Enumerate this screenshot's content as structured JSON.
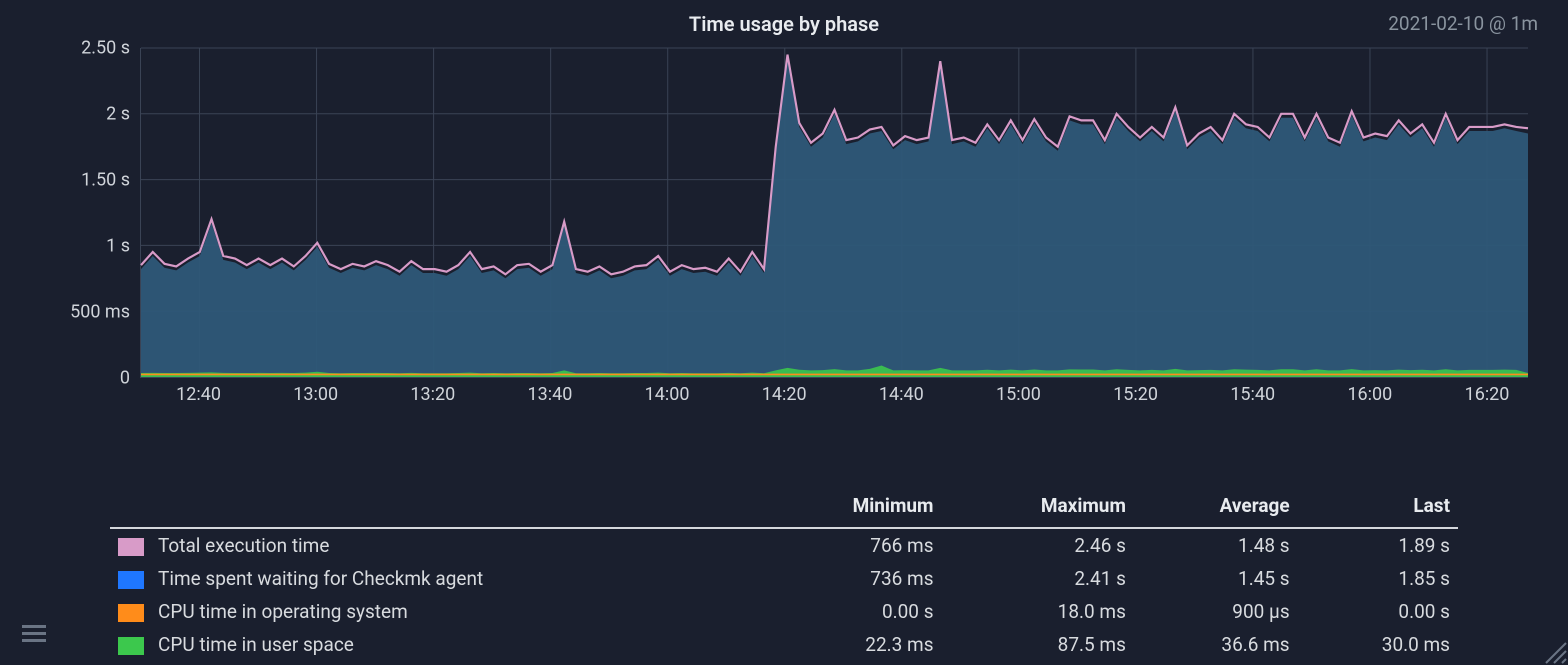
{
  "chart": {
    "title": "Time usage by phase",
    "timestamp": "2021-02-10 @ 1m"
  },
  "axes": {
    "y_ticks": [
      {
        "label": "0",
        "value": 0
      },
      {
        "label": "500 ms",
        "value": 0.5
      },
      {
        "label": "1 s",
        "value": 1.0
      },
      {
        "label": "1.50 s",
        "value": 1.5
      },
      {
        "label": "2 s",
        "value": 2.0
      },
      {
        "label": "2.50 s",
        "value": 2.5
      }
    ],
    "x_ticks": [
      "12:40",
      "13:00",
      "13:20",
      "13:40",
      "14:00",
      "14:20",
      "14:40",
      "15:00",
      "15:20",
      "15:40",
      "16:00",
      "16:20"
    ]
  },
  "legend": {
    "headers": [
      "",
      "Minimum",
      "Maximum",
      "Average",
      "Last"
    ],
    "rows": [
      {
        "label": "Total execution time",
        "color": "#d89bc8",
        "min": "766 ms",
        "max": "2.46 s",
        "avg": "1.48 s",
        "last": "1.89 s"
      },
      {
        "label": "Time spent waiting for Checkmk agent",
        "color": "#1f77ff",
        "min": "736 ms",
        "max": "2.41 s",
        "avg": "1.45 s",
        "last": "1.85 s"
      },
      {
        "label": "CPU time in operating system",
        "color": "#ff8c1a",
        "min": "0.00 s",
        "max": "18.0 ms",
        "avg": "900 µs",
        "last": "0.00 s"
      },
      {
        "label": "CPU time in user space",
        "color": "#3cc84d",
        "min": "22.3 ms",
        "max": "87.5 ms",
        "avg": "36.6 ms",
        "last": "30.0 ms"
      }
    ]
  },
  "chart_data": {
    "type": "area",
    "title": "Time usage by phase",
    "xlabel": "",
    "ylabel": "",
    "ylim": [
      0,
      2.5
    ],
    "x_range": [
      "12:30",
      "16:27"
    ],
    "x": [
      0,
      1,
      2,
      3,
      4,
      5,
      6,
      7,
      8,
      9,
      10,
      11,
      12,
      13,
      14,
      15,
      16,
      17,
      18,
      19,
      20,
      21,
      22,
      23,
      24,
      25,
      26,
      27,
      28,
      29,
      30,
      31,
      32,
      33,
      34,
      35,
      36,
      37,
      38,
      39,
      40,
      41,
      42,
      43,
      44,
      45,
      46,
      47,
      48,
      49,
      50,
      51,
      52,
      53,
      54,
      55,
      56,
      57,
      58,
      59,
      60,
      61,
      62,
      63,
      64,
      65,
      66,
      67,
      68,
      69,
      70,
      71,
      72,
      73,
      74,
      75,
      76,
      77,
      78,
      79,
      80,
      81,
      82,
      83,
      84,
      85,
      86,
      87,
      88,
      89,
      90,
      91,
      92,
      93,
      94,
      95,
      96,
      97,
      98,
      99,
      100,
      101,
      102,
      103,
      104,
      105,
      106,
      107,
      108,
      109,
      110,
      111,
      112,
      113,
      114,
      115,
      116,
      117,
      118
    ],
    "series": [
      {
        "name": "Total execution time",
        "color": "#d89bc8",
        "values": [
          0.85,
          0.95,
          0.86,
          0.84,
          0.9,
          0.95,
          1.2,
          0.92,
          0.9,
          0.85,
          0.9,
          0.85,
          0.9,
          0.84,
          0.92,
          1.02,
          0.86,
          0.82,
          0.86,
          0.84,
          0.88,
          0.85,
          0.8,
          0.88,
          0.82,
          0.82,
          0.8,
          0.85,
          0.95,
          0.82,
          0.84,
          0.78,
          0.85,
          0.86,
          0.8,
          0.85,
          1.18,
          0.82,
          0.8,
          0.84,
          0.78,
          0.8,
          0.84,
          0.85,
          0.92,
          0.8,
          0.85,
          0.82,
          0.83,
          0.8,
          0.9,
          0.8,
          0.95,
          0.82,
          1.75,
          2.45,
          1.93,
          1.78,
          1.85,
          2.03,
          1.8,
          1.82,
          1.88,
          1.9,
          1.76,
          1.83,
          1.8,
          1.82,
          2.4,
          1.8,
          1.82,
          1.78,
          1.92,
          1.8,
          1.95,
          1.8,
          1.96,
          1.82,
          1.75,
          1.98,
          1.95,
          1.95,
          1.8,
          2.0,
          1.9,
          1.82,
          1.9,
          1.82,
          2.05,
          1.76,
          1.85,
          1.9,
          1.8,
          2.0,
          1.92,
          1.9,
          1.82,
          2.0,
          2.0,
          1.82,
          2.0,
          1.82,
          1.78,
          2.02,
          1.82,
          1.85,
          1.83,
          1.95,
          1.85,
          1.92,
          1.78,
          2.0,
          1.8,
          1.9,
          1.9,
          1.9,
          1.92,
          1.9,
          1.89
        ]
      },
      {
        "name": "Time spent waiting for Checkmk agent",
        "color": "#1f77ff",
        "fill": "#2a5580",
        "values": [
          0.82,
          0.92,
          0.83,
          0.81,
          0.87,
          0.92,
          1.17,
          0.89,
          0.87,
          0.82,
          0.87,
          0.82,
          0.87,
          0.81,
          0.89,
          0.99,
          0.83,
          0.79,
          0.83,
          0.81,
          0.85,
          0.82,
          0.77,
          0.85,
          0.79,
          0.79,
          0.77,
          0.82,
          0.92,
          0.79,
          0.81,
          0.75,
          0.82,
          0.83,
          0.77,
          0.82,
          1.15,
          0.79,
          0.77,
          0.81,
          0.75,
          0.77,
          0.81,
          0.82,
          0.89,
          0.77,
          0.82,
          0.79,
          0.8,
          0.77,
          0.87,
          0.77,
          0.92,
          0.79,
          1.72,
          2.41,
          1.9,
          1.75,
          1.82,
          2.0,
          1.77,
          1.79,
          1.85,
          1.87,
          1.73,
          1.8,
          1.77,
          1.79,
          2.37,
          1.77,
          1.79,
          1.75,
          1.89,
          1.77,
          1.92,
          1.77,
          1.93,
          1.79,
          1.72,
          1.95,
          1.92,
          1.92,
          1.77,
          1.97,
          1.87,
          1.79,
          1.87,
          1.79,
          2.02,
          1.73,
          1.82,
          1.87,
          1.77,
          1.97,
          1.89,
          1.87,
          1.79,
          1.97,
          1.97,
          1.79,
          1.97,
          1.79,
          1.75,
          1.99,
          1.79,
          1.82,
          1.8,
          1.92,
          1.82,
          1.89,
          1.75,
          1.97,
          1.77,
          1.87,
          1.87,
          1.87,
          1.89,
          1.87,
          1.85
        ]
      },
      {
        "name": "CPU time in operating system",
        "color": "#ff8c1a",
        "values": [
          0.001,
          0.001,
          0.001,
          0.001,
          0.001,
          0.001,
          0.001,
          0.001,
          0.001,
          0.001,
          0.001,
          0.001,
          0.001,
          0.001,
          0.001,
          0.001,
          0.001,
          0.001,
          0.001,
          0.001,
          0.001,
          0.001,
          0.001,
          0.001,
          0.001,
          0.001,
          0.001,
          0.001,
          0.001,
          0.001,
          0.001,
          0.001,
          0.001,
          0.001,
          0.001,
          0.001,
          0.001,
          0.001,
          0.001,
          0.001,
          0.001,
          0.001,
          0.001,
          0.001,
          0.001,
          0.001,
          0.001,
          0.001,
          0.001,
          0.001,
          0.001,
          0.001,
          0.001,
          0.001,
          0.001,
          0.001,
          0.001,
          0.001,
          0.001,
          0.001,
          0.001,
          0.001,
          0.001,
          0.001,
          0.001,
          0.001,
          0.001,
          0.001,
          0.001,
          0.001,
          0.001,
          0.001,
          0.001,
          0.001,
          0.001,
          0.001,
          0.001,
          0.001,
          0.001,
          0.001,
          0.001,
          0.001,
          0.001,
          0.001,
          0.001,
          0.001,
          0.001,
          0.001,
          0.001,
          0.001,
          0.001,
          0.001,
          0.001,
          0.001,
          0.001,
          0.001,
          0.001,
          0.001,
          0.001,
          0.001,
          0.001,
          0.001,
          0.001,
          0.001,
          0.001,
          0.001,
          0.001,
          0.001,
          0.001,
          0.001,
          0.001,
          0.001,
          0.001,
          0.001,
          0.001,
          0.001,
          0.001,
          0.001,
          0.0
        ]
      },
      {
        "name": "CPU time in user space",
        "color": "#3cc84d",
        "values": [
          0.03,
          0.032,
          0.03,
          0.03,
          0.031,
          0.033,
          0.035,
          0.031,
          0.03,
          0.03,
          0.031,
          0.03,
          0.031,
          0.03,
          0.033,
          0.04,
          0.03,
          0.029,
          0.03,
          0.03,
          0.031,
          0.03,
          0.028,
          0.031,
          0.029,
          0.029,
          0.028,
          0.03,
          0.033,
          0.029,
          0.03,
          0.028,
          0.03,
          0.03,
          0.028,
          0.03,
          0.05,
          0.029,
          0.028,
          0.03,
          0.028,
          0.029,
          0.03,
          0.03,
          0.033,
          0.028,
          0.03,
          0.029,
          0.029,
          0.028,
          0.031,
          0.028,
          0.033,
          0.029,
          0.05,
          0.07,
          0.055,
          0.05,
          0.052,
          0.06,
          0.05,
          0.051,
          0.062,
          0.087,
          0.05,
          0.052,
          0.05,
          0.051,
          0.07,
          0.05,
          0.051,
          0.05,
          0.055,
          0.05,
          0.056,
          0.05,
          0.057,
          0.051,
          0.05,
          0.058,
          0.057,
          0.057,
          0.05,
          0.059,
          0.054,
          0.051,
          0.054,
          0.051,
          0.061,
          0.05,
          0.052,
          0.054,
          0.05,
          0.059,
          0.056,
          0.054,
          0.051,
          0.059,
          0.059,
          0.051,
          0.059,
          0.051,
          0.05,
          0.06,
          0.051,
          0.052,
          0.051,
          0.056,
          0.052,
          0.055,
          0.05,
          0.059,
          0.05,
          0.054,
          0.054,
          0.054,
          0.056,
          0.054,
          0.03
        ]
      }
    ]
  }
}
